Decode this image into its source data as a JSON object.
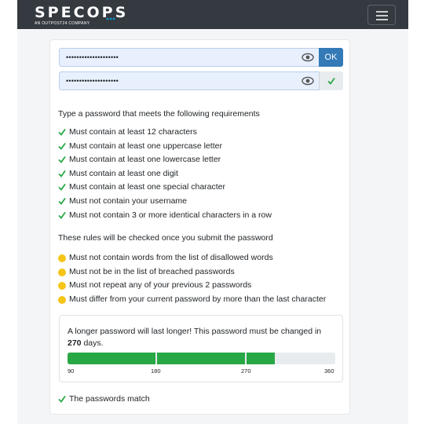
{
  "navbar": {
    "brand": "SPECOPS",
    "brand_sub": "AN OUTPOST24 COMPANY",
    "accent_color": "#00a3e0"
  },
  "form": {
    "new_password_masked": "••••••••••••••••••••",
    "confirm_password_masked": "••••••••••••••••••••",
    "ok_label": "OK",
    "show_password_icon": "eye-icon",
    "confirm_status_icon": "check-icon"
  },
  "requirements": {
    "intro": "Type a password that meets the following requirements",
    "items": [
      {
        "label": "Must contain at least 12 characters",
        "status": "met"
      },
      {
        "label": "Must contain at least one uppercase letter",
        "status": "met"
      },
      {
        "label": "Must contain at least one lowercase letter",
        "status": "met"
      },
      {
        "label": "Must contain at least one digit",
        "status": "met"
      },
      {
        "label": "Must contain at least one special character",
        "status": "met"
      },
      {
        "label": "Must not contain your username",
        "status": "met"
      },
      {
        "label": "Must not contain 3 or more identical characters in a row",
        "status": "met"
      }
    ]
  },
  "server_rules": {
    "intro": "These rules will be checked once you submit the password",
    "items": [
      {
        "label": "Must not contain words from the list of disallowed words",
        "status": "pending"
      },
      {
        "label": "Must not be in the list of breached passwords",
        "status": "pending"
      },
      {
        "label": "Must not repeat any of your previous 2 passwords",
        "status": "pending"
      },
      {
        "label": "Must differ from your current password by more than the last character",
        "status": "pending"
      }
    ]
  },
  "strength": {
    "message_prefix": "A longer password will last longer! This password must be changed in ",
    "days": "270",
    "message_suffix": " days.",
    "value_days": 270,
    "max_days": 360,
    "ticks": [
      "90",
      "180",
      "270",
      "360"
    ],
    "bar_color": "#28a745"
  },
  "match": {
    "label": "The passwords match",
    "status": "met"
  },
  "colors": {
    "check": "#28a745",
    "pending": "#f5c518",
    "primary": "#337ab7"
  }
}
